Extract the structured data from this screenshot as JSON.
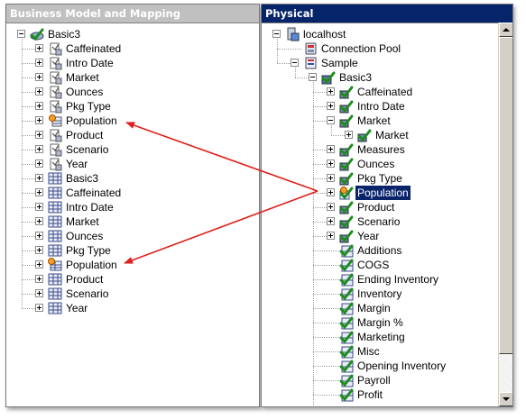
{
  "left_pane": {
    "title": "Business Model and Mapping",
    "root": "Basic3",
    "items": [
      {
        "label": "Caffeinated",
        "icon": "logical-table-icon"
      },
      {
        "label": "Intro Date",
        "icon": "logical-table-icon"
      },
      {
        "label": "Market",
        "icon": "logical-table-icon"
      },
      {
        "label": "Ounces",
        "icon": "logical-table-icon"
      },
      {
        "label": "Pkg Type",
        "icon": "logical-table-icon"
      },
      {
        "label": "Population",
        "icon": "fact-table-icon"
      },
      {
        "label": "Product",
        "icon": "logical-table-icon"
      },
      {
        "label": "Scenario",
        "icon": "logical-table-icon"
      },
      {
        "label": "Year",
        "icon": "logical-table-icon"
      },
      {
        "label": "Basic3",
        "icon": "dimension-icon"
      },
      {
        "label": "Caffeinated",
        "icon": "dimension-icon"
      },
      {
        "label": "Intro Date",
        "icon": "dimension-icon"
      },
      {
        "label": "Market",
        "icon": "dimension-icon"
      },
      {
        "label": "Ounces",
        "icon": "dimension-icon"
      },
      {
        "label": "Pkg Type",
        "icon": "dimension-icon"
      },
      {
        "label": "Population",
        "icon": "fact-dimension-icon"
      },
      {
        "label": "Product",
        "icon": "dimension-icon"
      },
      {
        "label": "Scenario",
        "icon": "dimension-icon"
      },
      {
        "label": "Year",
        "icon": "dimension-icon"
      }
    ]
  },
  "right_pane": {
    "title": "Physical",
    "localhost": "localhost",
    "connection_pool": "Connection Pool",
    "sample": "Sample",
    "basic3": "Basic3",
    "dimensions": [
      {
        "label": "Caffeinated",
        "expanded": false
      },
      {
        "label": "Intro Date",
        "expanded": false
      },
      {
        "label": "Market",
        "expanded": true
      },
      {
        "label": "Market",
        "expanded": false,
        "child": true
      },
      {
        "label": "Measures",
        "expanded": false
      },
      {
        "label": "Ounces",
        "expanded": false
      },
      {
        "label": "Pkg Type",
        "expanded": false
      },
      {
        "label": "Population",
        "expanded": false,
        "selected": true
      },
      {
        "label": "Product",
        "expanded": false
      },
      {
        "label": "Scenario",
        "expanded": false
      },
      {
        "label": "Year",
        "expanded": false
      }
    ],
    "measures": [
      "Additions",
      "COGS",
      "Ending Inventory",
      "Inventory",
      "Margin",
      "Margin %",
      "Marketing",
      "Misc",
      "Opening Inventory",
      "Payroll",
      "Profit"
    ]
  },
  "colors": {
    "active_header": "#06246a",
    "inactive_header": "#c0c0c0",
    "arrow": "#e0201c",
    "check": "#2a9a2a"
  }
}
